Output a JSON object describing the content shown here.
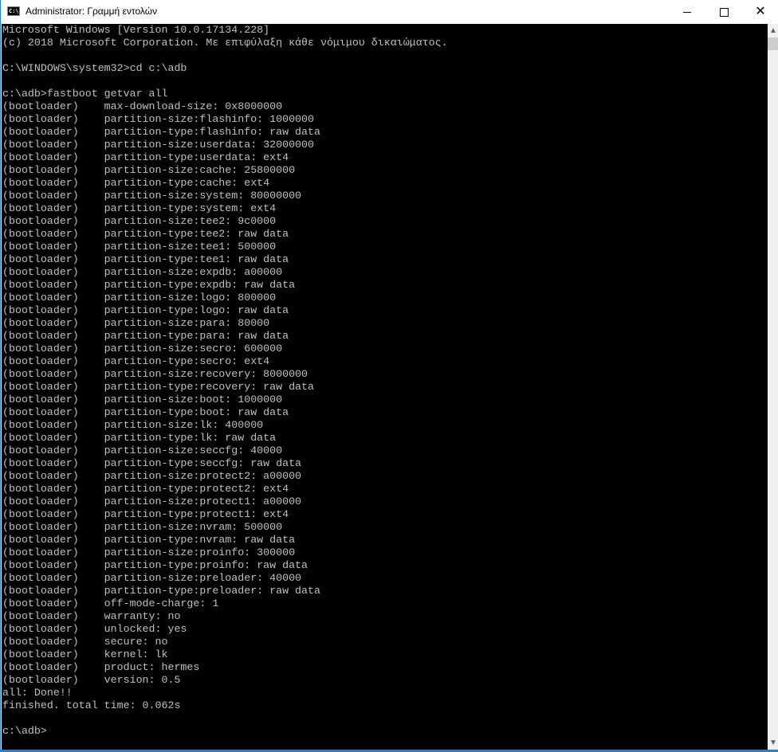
{
  "window": {
    "title": "Administrator: Γραμμή εντολών",
    "icon": "cmd-icon",
    "icon_text": "C:\\."
  },
  "controls": {
    "minimize": "minimize-icon",
    "maximize": "maximize-icon",
    "close": "close-icon",
    "close_glyph": "✕"
  },
  "scrollbar": {
    "up": "▲",
    "down": "▼",
    "position": 0.0
  },
  "console": {
    "lines": [
      "Microsoft Windows [Version 10.0.17134.228]",
      "(c) 2018 Microsoft Corporation. Με επιφύλαξη κάθε νόμιμου δικαιώματος.",
      "",
      "C:\\WINDOWS\\system32>cd c:\\adb",
      "",
      "c:\\adb>fastboot getvar all",
      "(bootloader)    max-download-size: 0x8000000",
      "(bootloader)    partition-size:flashinfo: 1000000",
      "(bootloader)    partition-type:flashinfo: raw data",
      "(bootloader)    partition-size:userdata: 32000000",
      "(bootloader)    partition-type:userdata: ext4",
      "(bootloader)    partition-size:cache: 25800000",
      "(bootloader)    partition-type:cache: ext4",
      "(bootloader)    partition-size:system: 80000000",
      "(bootloader)    partition-type:system: ext4",
      "(bootloader)    partition-size:tee2: 9c0000",
      "(bootloader)    partition-type:tee2: raw data",
      "(bootloader)    partition-size:tee1: 500000",
      "(bootloader)    partition-type:tee1: raw data",
      "(bootloader)    partition-size:expdb: a00000",
      "(bootloader)    partition-type:expdb: raw data",
      "(bootloader)    partition-size:logo: 800000",
      "(bootloader)    partition-type:logo: raw data",
      "(bootloader)    partition-size:para: 80000",
      "(bootloader)    partition-type:para: raw data",
      "(bootloader)    partition-size:secro: 600000",
      "(bootloader)    partition-type:secro: ext4",
      "(bootloader)    partition-size:recovery: 8000000",
      "(bootloader)    partition-type:recovery: raw data",
      "(bootloader)    partition-size:boot: 1000000",
      "(bootloader)    partition-type:boot: raw data",
      "(bootloader)    partition-size:lk: 400000",
      "(bootloader)    partition-type:lk: raw data",
      "(bootloader)    partition-size:seccfg: 40000",
      "(bootloader)    partition-type:seccfg: raw data",
      "(bootloader)    partition-size:protect2: a00000",
      "(bootloader)    partition-type:protect2: ext4",
      "(bootloader)    partition-size:protect1: a00000",
      "(bootloader)    partition-type:protect1: ext4",
      "(bootloader)    partition-size:nvram: 500000",
      "(bootloader)    partition-type:nvram: raw data",
      "(bootloader)    partition-size:proinfo: 300000",
      "(bootloader)    partition-type:proinfo: raw data",
      "(bootloader)    partition-size:preloader: 40000",
      "(bootloader)    partition-type:preloader: raw data",
      "(bootloader)    off-mode-charge: 1",
      "(bootloader)    warranty: no",
      "(bootloader)    unlocked: yes",
      "(bootloader)    secure: no",
      "(bootloader)    kernel: lk",
      "(bootloader)    product: hermes",
      "(bootloader)    version: 0.5",
      "all: Done!!",
      "finished. total time: 0.062s",
      "",
      "c:\\adb>"
    ]
  }
}
